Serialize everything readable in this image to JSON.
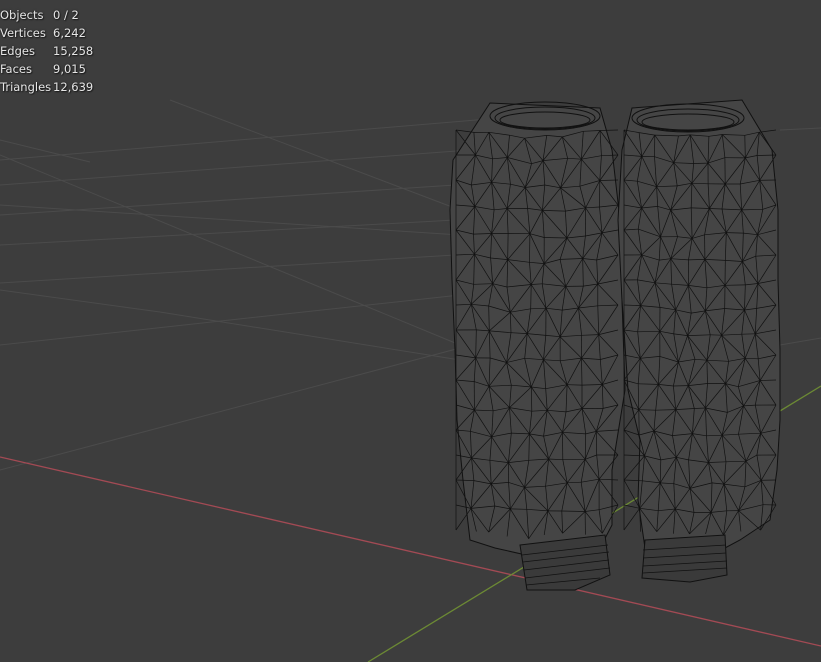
{
  "overlay_stats": [
    {
      "label": "Objects",
      "value": "0 / 2"
    },
    {
      "label": "Vertices",
      "value": "6,242"
    },
    {
      "label": "Edges",
      "value": "15,258"
    },
    {
      "label": "Faces",
      "value": "9,015"
    },
    {
      "label": "Triangles",
      "value": "12,639"
    }
  ],
  "colors": {
    "viewport_background": "#3d3d3d",
    "grid_line": "#4a4a4a",
    "x_axis": "#a34a54",
    "y_axis": "#6c8a34",
    "wire": "#111111",
    "mesh_fill": "#454545",
    "overlay_text": "#e6e6e6"
  },
  "icons": [
    "floor-grid",
    "x-axis-line",
    "y-axis-line",
    "wireframe-mesh"
  ]
}
